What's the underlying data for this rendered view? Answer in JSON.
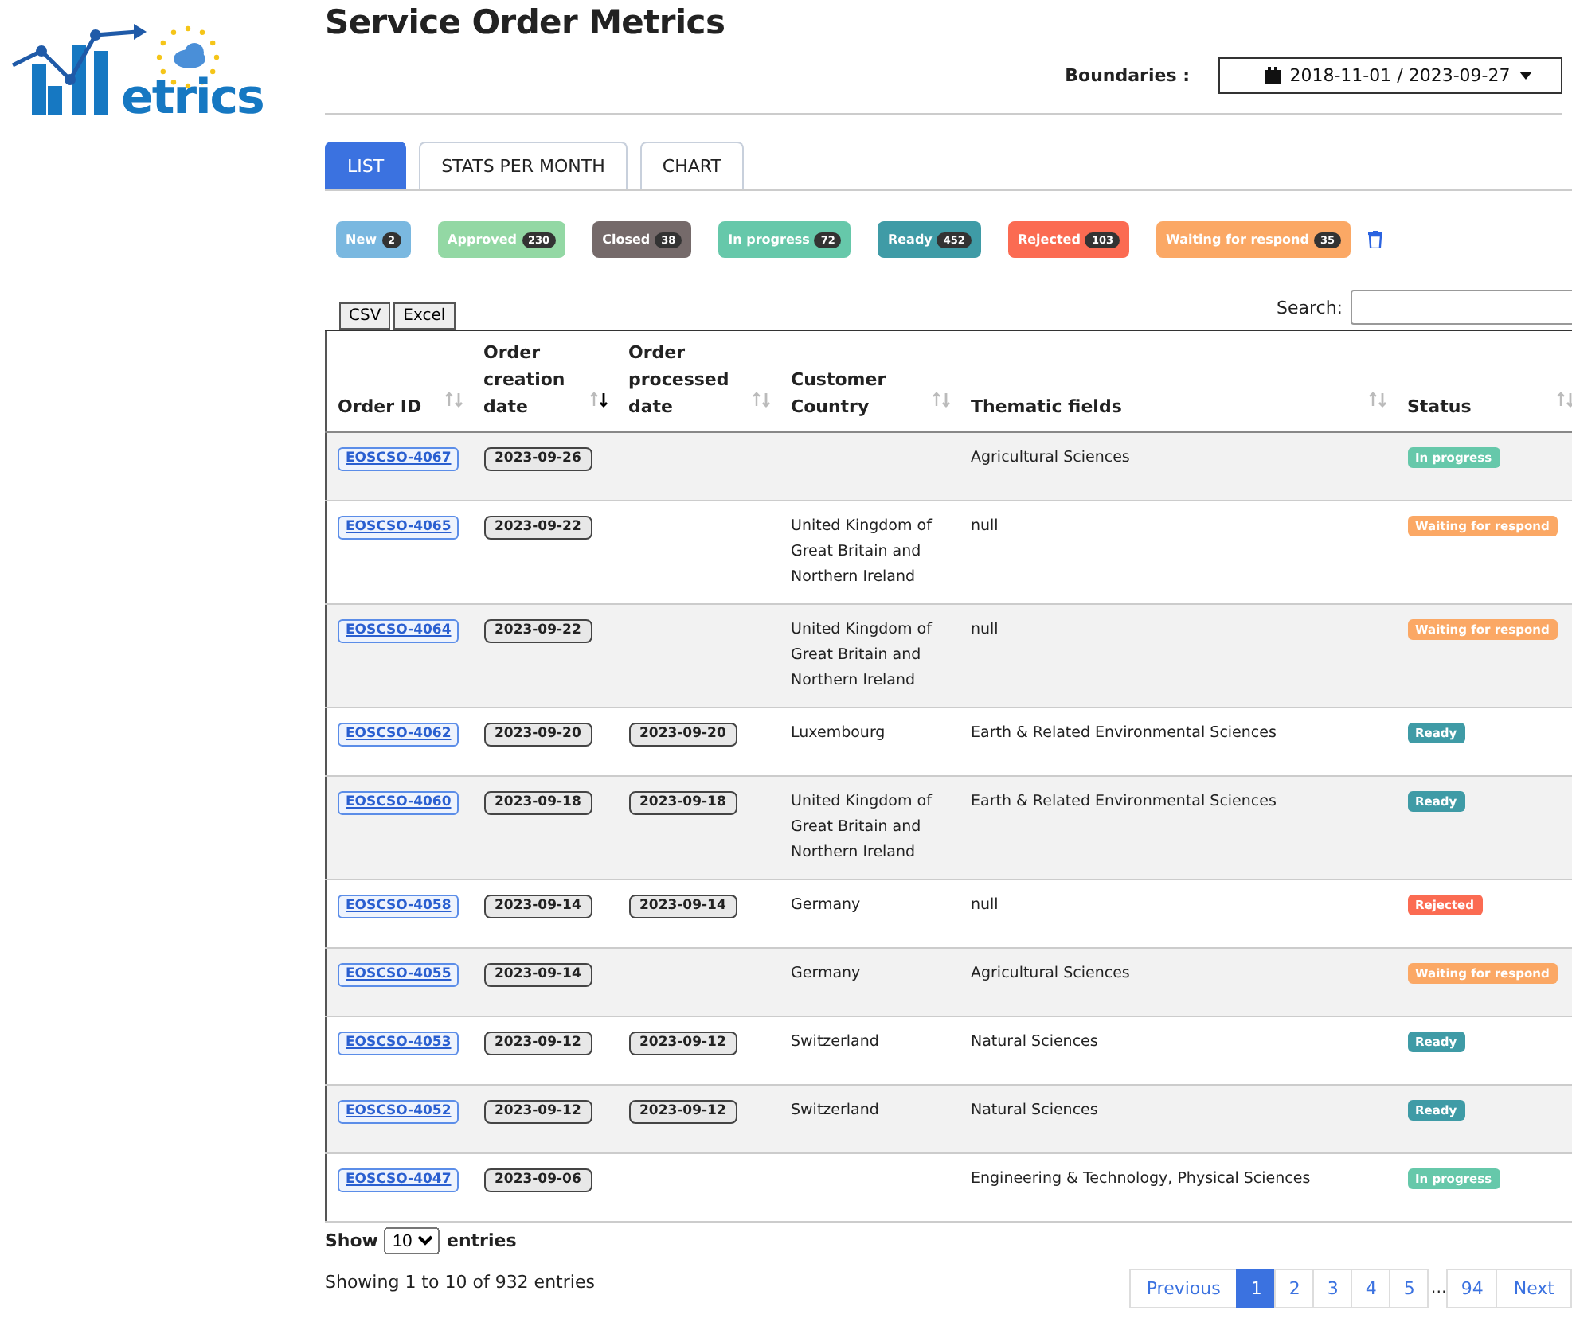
{
  "logo": {
    "text": "etrics"
  },
  "title": "Service Order Metrics",
  "boundaries": {
    "label": "Boundaries :",
    "value": "2018-11-01 / 2023-09-27"
  },
  "tabs": [
    {
      "label": "LIST",
      "selected": true
    },
    {
      "label": "STATS PER MONTH",
      "selected": false
    },
    {
      "label": "CHART",
      "selected": false
    }
  ],
  "filters": [
    {
      "label": "New",
      "count": "2",
      "color": "#7ab8e0"
    },
    {
      "label": "Approved",
      "count": "230",
      "color": "#93d8a4"
    },
    {
      "label": "Closed",
      "count": "38",
      "color": "#756a6a"
    },
    {
      "label": "In progress",
      "count": "72",
      "color": "#66c8aa"
    },
    {
      "label": "Ready",
      "count": "452",
      "color": "#3f9ba6"
    },
    {
      "label": "Rejected",
      "count": "103",
      "color": "#fb6b52"
    },
    {
      "label": "Waiting for respond",
      "count": "35",
      "color": "#fba865"
    }
  ],
  "export_buttons": [
    "CSV",
    "Excel"
  ],
  "search": {
    "label": "Search:"
  },
  "table": {
    "columns": [
      {
        "label": "Order ID",
        "sorted": false
      },
      {
        "label": "Order creation date",
        "sorted": true
      },
      {
        "label": "Order processed date",
        "sorted": false
      },
      {
        "label": "Customer Country",
        "sorted": false
      },
      {
        "label": "Thematic fields",
        "sorted": false
      },
      {
        "label": "Status",
        "sorted": false
      }
    ],
    "rows": [
      {
        "id": "EOSCSO-4067",
        "created": "2023-09-26",
        "processed": "",
        "country": "",
        "fields": "Agricultural Sciences",
        "status": "In progress",
        "color": "#66c8aa"
      },
      {
        "id": "EOSCSO-4065",
        "created": "2023-09-22",
        "processed": "",
        "country": "United Kingdom of Great Britain and Northern Ireland",
        "fields": "null",
        "status": "Waiting for respond",
        "color": "#fba865"
      },
      {
        "id": "EOSCSO-4064",
        "created": "2023-09-22",
        "processed": "",
        "country": "United Kingdom of Great Britain and Northern Ireland",
        "fields": "null",
        "status": "Waiting for respond",
        "color": "#fba865"
      },
      {
        "id": "EOSCSO-4062",
        "created": "2023-09-20",
        "processed": "2023-09-20",
        "country": "Luxembourg",
        "fields": "Earth & Related Environmental Sciences",
        "status": "Ready",
        "color": "#3f9ba6"
      },
      {
        "id": "EOSCSO-4060",
        "created": "2023-09-18",
        "processed": "2023-09-18",
        "country": "United Kingdom of Great Britain and Northern Ireland",
        "fields": "Earth & Related Environmental Sciences",
        "status": "Ready",
        "color": "#3f9ba6"
      },
      {
        "id": "EOSCSO-4058",
        "created": "2023-09-14",
        "processed": "2023-09-14",
        "country": "Germany",
        "fields": "null",
        "status": "Rejected",
        "color": "#fb6b52"
      },
      {
        "id": "EOSCSO-4055",
        "created": "2023-09-14",
        "processed": "",
        "country": "Germany",
        "fields": "Agricultural Sciences",
        "status": "Waiting for respond",
        "color": "#fba865"
      },
      {
        "id": "EOSCSO-4053",
        "created": "2023-09-12",
        "processed": "2023-09-12",
        "country": "Switzerland",
        "fields": "Natural Sciences",
        "status": "Ready",
        "color": "#3f9ba6"
      },
      {
        "id": "EOSCSO-4052",
        "created": "2023-09-12",
        "processed": "2023-09-12",
        "country": "Switzerland",
        "fields": "Natural Sciences",
        "status": "Ready",
        "color": "#3f9ba6"
      },
      {
        "id": "EOSCSO-4047",
        "created": "2023-09-06",
        "processed": "",
        "country": "",
        "fields": "Engineering & Technology, Physical Sciences",
        "status": "In progress",
        "color": "#66c8aa"
      }
    ]
  },
  "length": {
    "before": "Show",
    "value": "10",
    "after": "entries"
  },
  "info": "Showing 1 to 10 of 932 entries",
  "pagination": {
    "previous": "Previous",
    "pages": [
      {
        "label": "1",
        "selected": true
      },
      {
        "label": "2",
        "selected": false
      },
      {
        "label": "3",
        "selected": false
      },
      {
        "label": "4",
        "selected": false
      },
      {
        "label": "5",
        "selected": false
      }
    ],
    "ellipsis": "…",
    "last": "94",
    "next": "Next"
  }
}
